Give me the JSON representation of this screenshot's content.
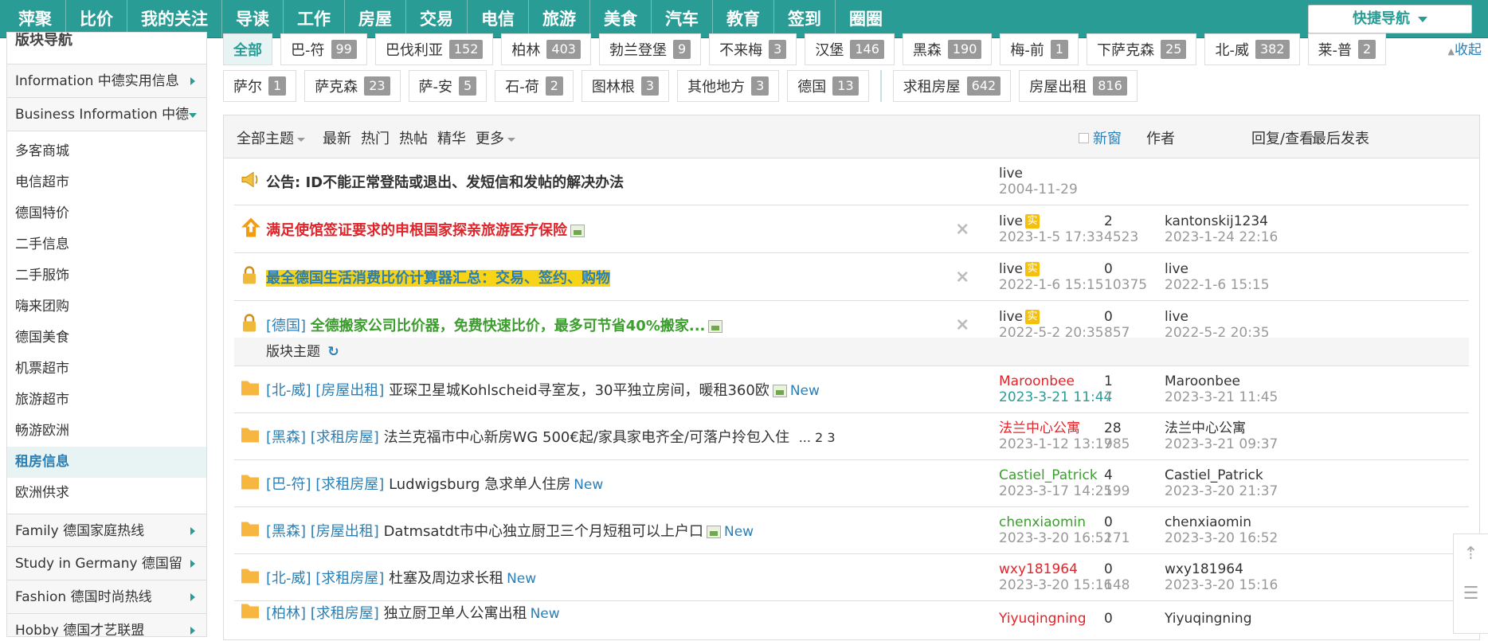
{
  "topnav": {
    "items": [
      "萍聚",
      "比价",
      "我的关注",
      "导读",
      "工作",
      "房屋",
      "交易",
      "电信",
      "旅游",
      "美食",
      "汽车",
      "教育",
      "签到",
      "圈圈"
    ],
    "quick_nav": "快捷导航"
  },
  "sidebar": {
    "heading": "版块导航",
    "sections": [
      {
        "label": "Information 中德实用信息",
        "state": "collapsed"
      },
      {
        "label": "Business Information 中德",
        "state": "expanded"
      }
    ],
    "items": [
      "多客商城",
      "电信超市",
      "德国特价",
      "二手信息",
      "二手服饰",
      "嗨来团购",
      "德国美食",
      "机票超市",
      "旅游超市",
      "畅游欧洲",
      "租房信息",
      "欧洲供求"
    ],
    "active_item": "租房信息",
    "more_sections": [
      "Family 德国家庭热线",
      "Study in Germany 德国留",
      "Fashion 德国时尚热线",
      "Hobby 德国才艺联盟"
    ]
  },
  "forum_tags": {
    "row1": [
      {
        "name": "全部",
        "count": ""
      },
      {
        "name": "巴-符",
        "count": "99"
      },
      {
        "name": "巴伐利亚",
        "count": "152"
      },
      {
        "name": "柏林",
        "count": "403"
      },
      {
        "name": "勃兰登堡",
        "count": "9"
      },
      {
        "name": "不来梅",
        "count": "3"
      },
      {
        "name": "汉堡",
        "count": "146"
      },
      {
        "name": "黑森",
        "count": "190"
      },
      {
        "name": "梅-前",
        "count": "1"
      },
      {
        "name": "下萨克森",
        "count": "25"
      },
      {
        "name": "北-威",
        "count": "382"
      },
      {
        "name": "莱-普",
        "count": "2"
      }
    ],
    "row2": [
      {
        "name": "萨尔",
        "count": "1"
      },
      {
        "name": "萨克森",
        "count": "23"
      },
      {
        "name": "萨-安",
        "count": "5"
      },
      {
        "name": "石-荷",
        "count": "2"
      },
      {
        "name": "图林根",
        "count": "3"
      },
      {
        "name": "其他地方",
        "count": "3"
      },
      {
        "name": "德国",
        "count": "13"
      }
    ],
    "row2_extra": [
      {
        "name": "求租房屋",
        "count": "642"
      },
      {
        "name": "房屋出租",
        "count": "816"
      }
    ],
    "collapse": "收起"
  },
  "thread_header": {
    "all_topics": "全部主题",
    "tabs": [
      "最新",
      "热门",
      "热帖",
      "精华",
      "更多"
    ],
    "new_window": "新窗",
    "col_author": "作者",
    "col_replies": "回复/查看",
    "col_last": "最后发表"
  },
  "pinned": [
    {
      "prefix": "",
      "title": "公告: ID不能正常登陆或退出、发短信和发帖的解决办法",
      "author": "live",
      "date": "2004-11-29",
      "replies": "",
      "views": "",
      "last_user": "",
      "last_date": "",
      "color": "#333333"
    },
    {
      "prefix": "",
      "title": "满足使馆签证要求的申根国家探亲旅游医疗保险",
      "author": "live",
      "date": "2023-1-5 17:33",
      "replies": "2",
      "views": "4523",
      "last_user": "kantonskij1234",
      "last_date": "2023-1-24 22:16",
      "color": "#e0242a"
    },
    {
      "prefix": "",
      "title": "最全德国生活消费比价计算器汇总：交易、签约、购物",
      "author": "live",
      "date": "2022-1-6 15:15",
      "replies": "0",
      "views": "10375",
      "last_user": "live",
      "last_date": "2022-1-6 15:15",
      "color": "#2a7fb6"
    },
    {
      "prefix": "[德国]",
      "title": "全德搬家公司比价器，免费快速比价，最多可节省40%搬家...",
      "author": "live",
      "date": "2022-5-2 20:35",
      "replies": "0",
      "views": "857",
      "last_user": "live",
      "last_date": "2022-5-2 20:35",
      "color": "#3c9e2e"
    }
  ],
  "shi_badge": "实",
  "section_label": "版块主题",
  "threads": [
    {
      "tag1": "[北-威]",
      "tag2": "[房屋出租]",
      "title": "亚琛卫星城Kohlscheid寻室友，30平独立房间，暖租360欧",
      "author": "Maroonbee",
      "author_color": "#e0242a",
      "date": "2023-3-21 11:44",
      "replies": "1",
      "views": "7",
      "last_user": "Maroonbee",
      "last_date": "2023-3-21 11:45",
      "new": "New",
      "pages": ""
    },
    {
      "tag1": "[黑森]",
      "tag2": "[求租房屋]",
      "title": "法兰克福市中心新房WG 500€起/家具家电齐全/可落户拎包入住",
      "author": "法兰中心公寓",
      "author_color": "#e0242a",
      "date": "2023-1-12 13:17",
      "replies": "28",
      "views": "985",
      "last_user": "法兰中心公寓",
      "last_date": "2023-3-21 09:37",
      "new": "",
      "pages": "... 2  3"
    },
    {
      "tag1": "[巴-符]",
      "tag2": "[求租房屋]",
      "title": "Ludwigsburg 急求单人住房",
      "author": "Castiel_Patrick",
      "author_color": "#3c9e2e",
      "date": "2023-3-17 14:25",
      "replies": "4",
      "views": "199",
      "last_user": "Castiel_Patrick",
      "last_date": "2023-3-20 21:37",
      "new": "New",
      "pages": ""
    },
    {
      "tag1": "[黑森]",
      "tag2": "[房屋出租]",
      "title": "Datmsatdt市中心独立厨卫三个月短租可以上户口",
      "author": "chenxiaomin",
      "author_color": "#3c9e2e",
      "date": "2023-3-20 16:52",
      "replies": "0",
      "views": "171",
      "last_user": "chenxiaomin",
      "last_date": "2023-3-20 16:52",
      "new": "New",
      "pages": ""
    },
    {
      "tag1": "[北-威]",
      "tag2": "[求租房屋]",
      "title": "杜塞及周边求长租",
      "author": "wxy181964",
      "author_color": "#e0242a",
      "date": "2023-3-20 15:16",
      "replies": "0",
      "views": "148",
      "last_user": "wxy181964",
      "last_date": "2023-3-20 15:16",
      "new": "New",
      "pages": ""
    },
    {
      "tag1": "[柏林]",
      "tag2": "[求租房屋]",
      "title": "独立厨卫单人公寓出租",
      "author": "Yiyuqingning",
      "author_color": "#e0242a",
      "date": "",
      "replies": "0",
      "views": "",
      "last_user": "Yiyuqingning",
      "last_date": "",
      "new": "New",
      "pages": ""
    }
  ]
}
